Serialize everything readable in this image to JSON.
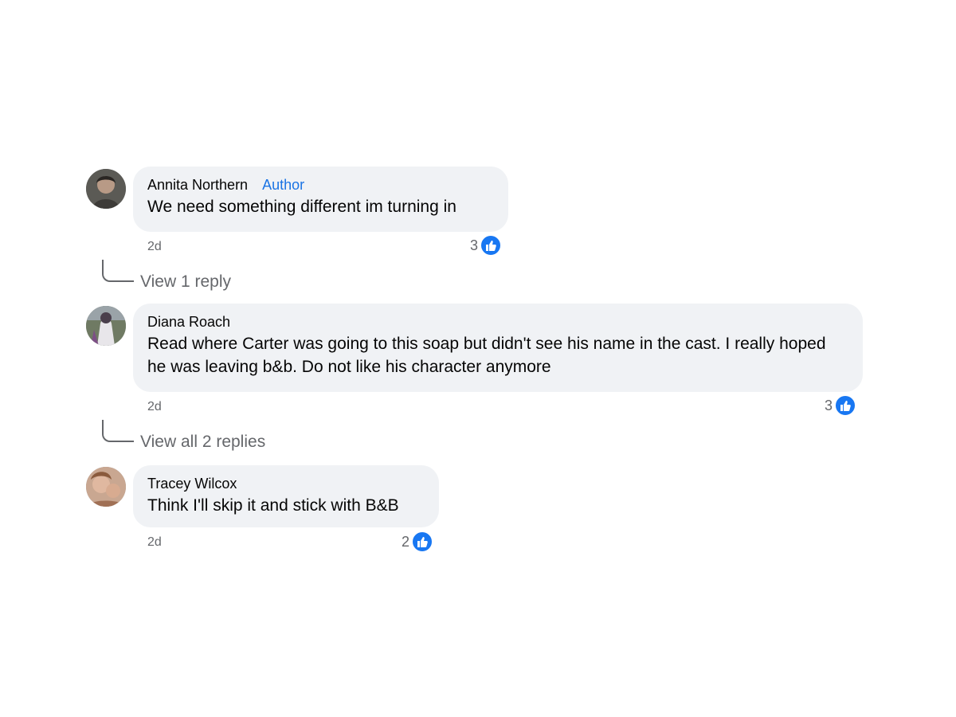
{
  "comments": [
    {
      "author": "Annita Northern",
      "badge": "Author",
      "text": "We need something different im turning in",
      "time": "2d",
      "reaction_count": "3",
      "reaction_icon": "like-icon",
      "view_replies": "View 1 reply"
    },
    {
      "author": "Diana Roach",
      "text": "Read where Carter was going to this soap but didn't see his name in the cast. I really hoped he was leaving b&b. Do not like his character anymore",
      "time": "2d",
      "reaction_count": "3",
      "reaction_icon": "like-icon",
      "view_replies": "View all 2 replies"
    },
    {
      "author": "Tracey Wilcox",
      "text": "Think I'll skip it and stick with B&B",
      "time": "2d",
      "reaction_count": "2",
      "reaction_icon": "like-icon"
    }
  ],
  "colors": {
    "bubble": "#f0f2f5",
    "link_blue": "#1b74e4",
    "like_blue": "#1877f2",
    "secondary_text": "#65676b"
  }
}
